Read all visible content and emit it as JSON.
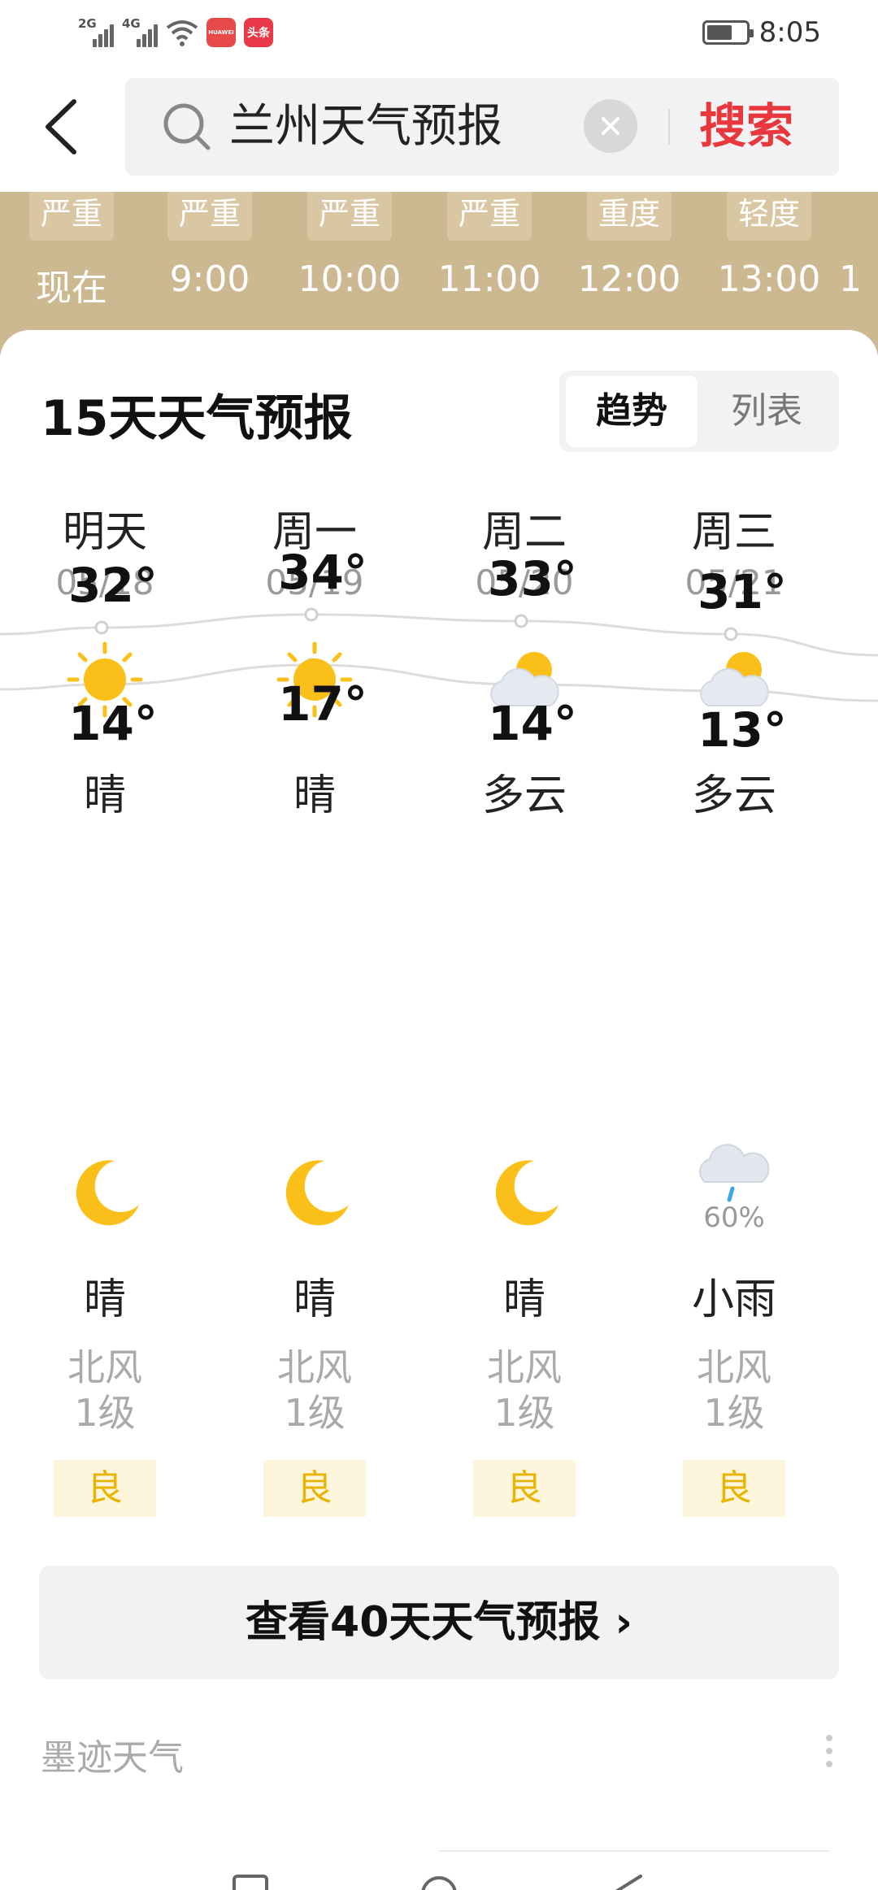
{
  "status_bar": {
    "signal1": "2G",
    "signal2": "4G",
    "app1": "HUAWEI",
    "app2": "头条",
    "time": "8:05"
  },
  "search": {
    "query": "兰州天气预报",
    "button": "搜索"
  },
  "hourly": [
    {
      "aqi": "严重",
      "time": "现在"
    },
    {
      "aqi": "严重",
      "time": "9:00"
    },
    {
      "aqi": "严重",
      "time": "10:00"
    },
    {
      "aqi": "严重",
      "time": "11:00"
    },
    {
      "aqi": "重度",
      "time": "12:00"
    },
    {
      "aqi": "轻度",
      "time": "13:00"
    },
    {
      "aqi": "",
      "time": "1"
    }
  ],
  "forecast": {
    "title": "15天天气预报",
    "toggle": {
      "trend": "趋势",
      "list": "列表"
    },
    "days": [
      {
        "name": "明天",
        "date": "05/18",
        "day_icon": "sun-icon",
        "day_cond": "晴",
        "high": "32°",
        "high_value": 32,
        "low": "14°",
        "low_value": 14,
        "night_icon": "moon-icon",
        "precip": "",
        "night_cond": "晴",
        "wind_dir": "北风",
        "wind_lvl": "1级",
        "aqi": "良"
      },
      {
        "name": "周一",
        "date": "05/19",
        "day_icon": "sun-icon",
        "day_cond": "晴",
        "high": "34°",
        "high_value": 34,
        "low": "17°",
        "low_value": 17,
        "night_icon": "moon-icon",
        "precip": "",
        "night_cond": "晴",
        "wind_dir": "北风",
        "wind_lvl": "1级",
        "aqi": "良"
      },
      {
        "name": "周二",
        "date": "05/20",
        "day_icon": "partly-cloudy-icon",
        "day_cond": "多云",
        "high": "33°",
        "high_value": 33,
        "low": "14°",
        "low_value": 14,
        "night_icon": "moon-icon",
        "precip": "",
        "night_cond": "晴",
        "wind_dir": "北风",
        "wind_lvl": "1级",
        "aqi": "良"
      },
      {
        "name": "周三",
        "date": "05/21",
        "day_icon": "partly-cloudy-icon",
        "day_cond": "多云",
        "high": "31°",
        "high_value": 31,
        "low": "13°",
        "low_value": 13,
        "night_icon": "light-rain-icon",
        "precip": "60%",
        "night_cond": "小雨",
        "wind_dir": "北风",
        "wind_lvl": "1级",
        "aqi": "良"
      }
    ],
    "more_button": "查看40天天气预报 ›",
    "source": "墨迹天气"
  },
  "colors": {
    "accent_red": "#e8383d",
    "hourly_bg": "#cdb991",
    "aqi_good_text": "#e8b400",
    "aqi_good_bg": "#fdf5dc",
    "sun": "#fbbf1a"
  }
}
